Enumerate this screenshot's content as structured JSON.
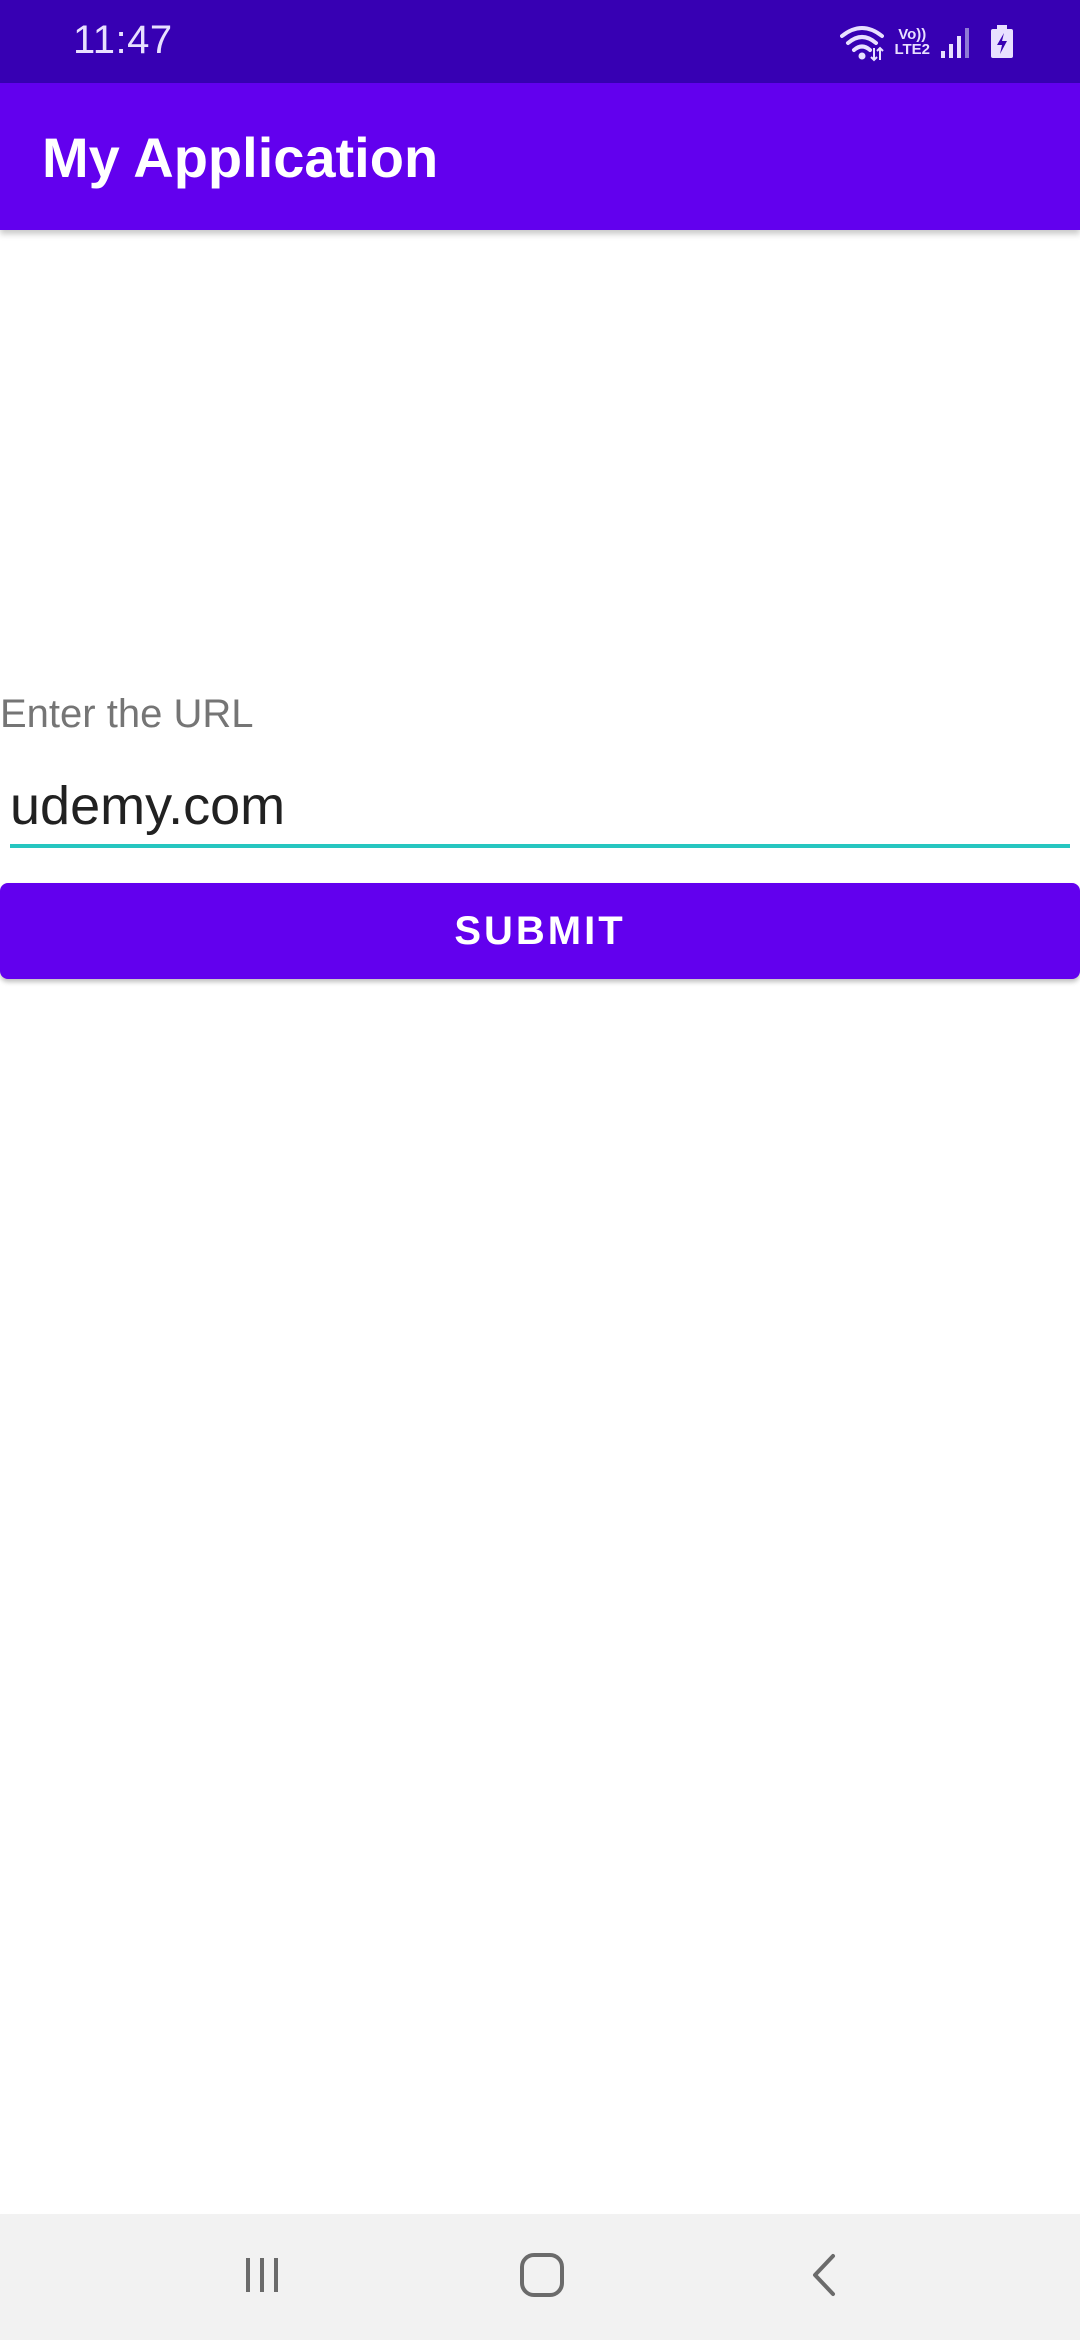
{
  "status_bar": {
    "time": "11:47",
    "volte_top": "Vo))",
    "volte_bottom": "LTE2",
    "icons": [
      "wifi-icon",
      "volte-icon",
      "signal-icon",
      "battery-charging-icon"
    ]
  },
  "app_bar": {
    "title": "My Application"
  },
  "form": {
    "label": "Enter the URL",
    "url_value": "udemy.com",
    "submit_label": "SUBMIT"
  },
  "nav_bar": {
    "icons": [
      "recent-apps-icon",
      "home-icon",
      "back-icon"
    ]
  },
  "colors": {
    "status_bar": "#3700b3",
    "primary": "#6200ee",
    "accent_underline": "#26c6c0",
    "nav_bar": "#f2f2f2"
  }
}
